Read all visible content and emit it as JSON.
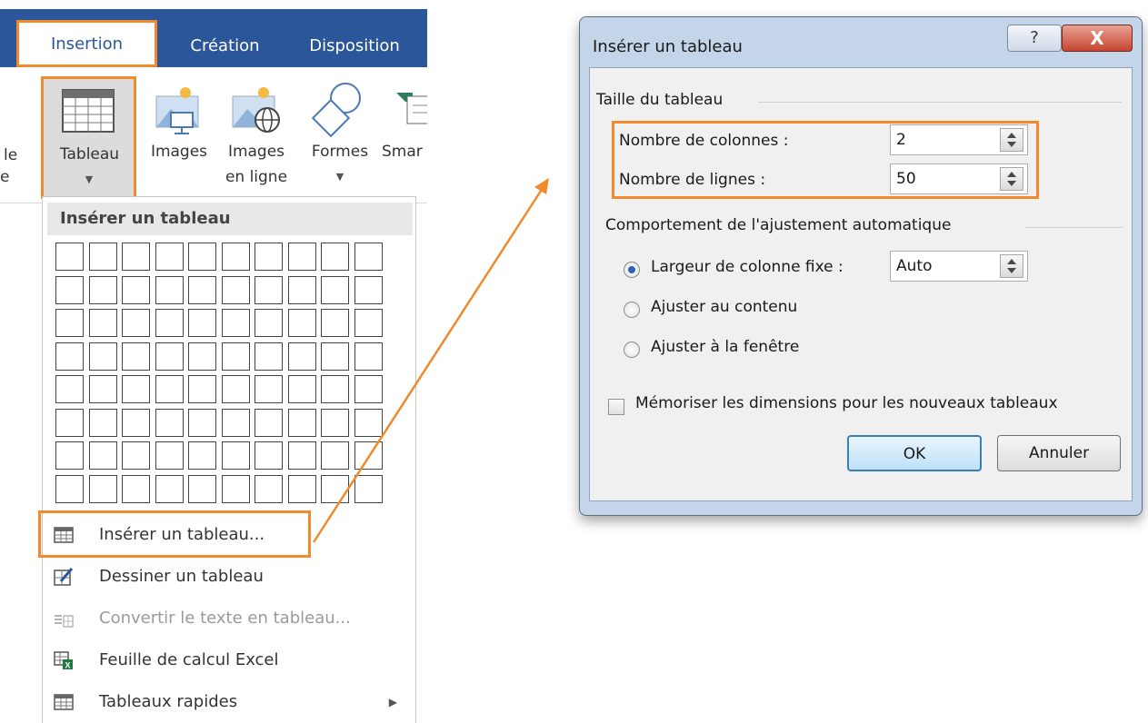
{
  "ribbon": {
    "tabs": [
      {
        "label": "Insertion",
        "active": true
      },
      {
        "label": "Création"
      },
      {
        "label": "Disposition"
      }
    ],
    "left_cut": [
      "le",
      "e"
    ],
    "buttons": [
      {
        "label": "Tableau",
        "icon": "table-icon"
      },
      {
        "label": "Images",
        "icon": "picture-icon"
      },
      {
        "label_line1": "Images",
        "label_line2": "en ligne",
        "icon": "online-picture-icon"
      },
      {
        "label": "Formes",
        "icon": "shapes-icon"
      },
      {
        "label": "Smar",
        "icon": "smartart-icon"
      }
    ]
  },
  "menu": {
    "header": "Insérer un tableau",
    "grid": {
      "columns": 10,
      "rows": 8
    },
    "items": [
      {
        "label": "Insérer un tableau...",
        "icon": "table-icon",
        "disabled": false
      },
      {
        "label": "Dessiner un tableau",
        "icon": "draw-table-icon",
        "disabled": false
      },
      {
        "label": "Convertir le texte en tableau...",
        "icon": "convert-text-icon",
        "disabled": true
      },
      {
        "label": "Feuille de calcul Excel",
        "icon": "excel-icon",
        "disabled": false
      },
      {
        "label": "Tableaux rapides",
        "icon": "quick-tables-icon",
        "disabled": false,
        "submenu": true
      }
    ]
  },
  "dialog": {
    "title": "Insérer un tableau",
    "help_label": "?",
    "close_label": "X",
    "size_group": "Taille du tableau",
    "columns_label": "Nombre de colonnes :",
    "columns_value": "2",
    "rows_label": "Nombre de lignes :",
    "rows_value": "50",
    "autofit_group": "Comportement de l'ajustement automatique",
    "fixed_width_label": "Largeur de colonne fixe :",
    "fixed_width_value": "Auto",
    "autofit_content_label": "Ajuster au contenu",
    "autofit_window_label": "Ajuster à la fenêtre",
    "selected_option": "fixed",
    "remember_label": "Mémoriser les dimensions pour les nouveaux tableaux",
    "remember_checked": false,
    "ok_label": "OK",
    "cancel_label": "Annuler"
  },
  "colors": {
    "highlight": "#f08a2c",
    "ribbon": "#2b579a",
    "dialog_frame": "#c4d5ea"
  }
}
